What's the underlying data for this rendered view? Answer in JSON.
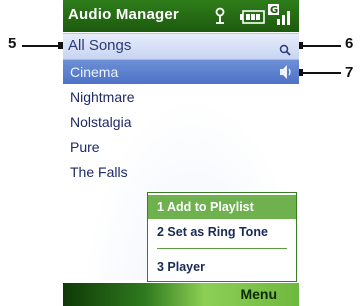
{
  "window": {
    "title": "Audio Manager",
    "status_icons": [
      "antenna-icon",
      "battery-icon",
      "signal-icon"
    ]
  },
  "category": {
    "label": "All Songs",
    "icon": "search-icon"
  },
  "songs": [
    {
      "label": "Cinema",
      "selected": true
    },
    {
      "label": "Nightmare",
      "selected": false
    },
    {
      "label": "Nolstalgia",
      "selected": false
    },
    {
      "label": "Pure",
      "selected": false
    },
    {
      "label": "The Falls",
      "selected": false
    }
  ],
  "selected_song_icon": "speaker-icon",
  "popup_menu": {
    "items": [
      {
        "label": "1 Add to Playlist",
        "highlighted": true
      },
      {
        "label": "2 Set as Ring Tone",
        "highlighted": false
      },
      {
        "label": "3 Player",
        "highlighted": false
      }
    ]
  },
  "softkeys": {
    "right": "Menu"
  },
  "callouts": [
    "5",
    "6",
    "7"
  ],
  "colors": {
    "title_bar": "#2e7d1a",
    "selection": "#5a7fcf",
    "menu_highlight": "#6fb04f",
    "category_bar": "#d6e0f6"
  }
}
